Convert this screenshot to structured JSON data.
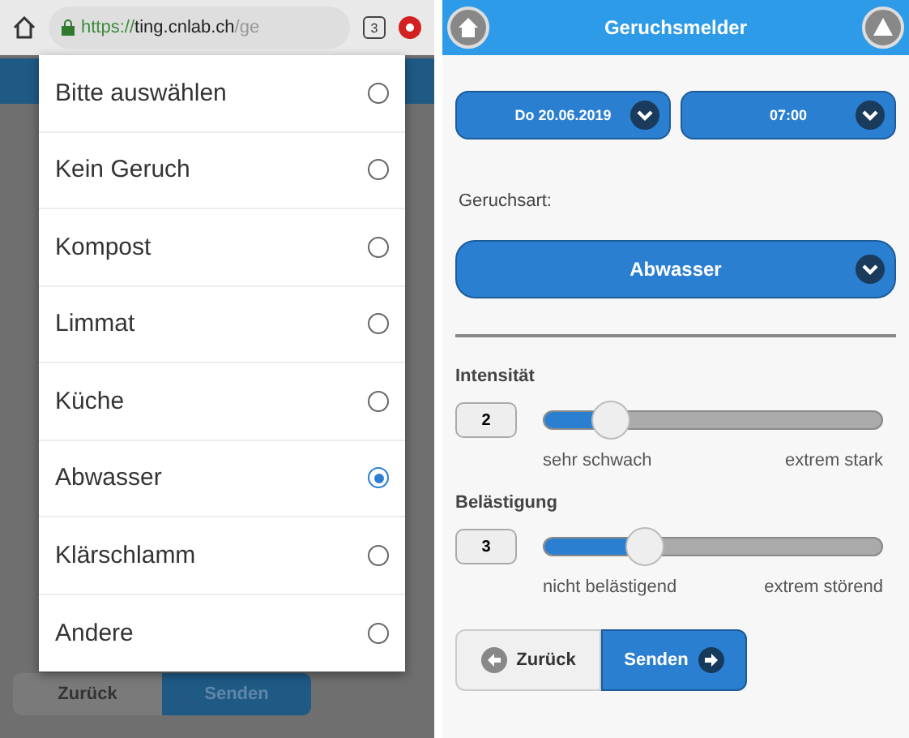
{
  "browser": {
    "url": {
      "scheme": "https://",
      "host": "ting.cnlab.ch",
      "path": "/ge"
    },
    "tab_count": "3"
  },
  "picker": {
    "options": [
      {
        "label": "Bitte auswählen",
        "selected": false
      },
      {
        "label": "Kein Geruch",
        "selected": false
      },
      {
        "label": "Kompost",
        "selected": false
      },
      {
        "label": "Limmat",
        "selected": false
      },
      {
        "label": "Küche",
        "selected": false
      },
      {
        "label": "Abwasser",
        "selected": true
      },
      {
        "label": "Klärschlamm",
        "selected": false
      },
      {
        "label": "Andere",
        "selected": false
      }
    ]
  },
  "background_buttons": [
    "Zurück",
    "Senden"
  ],
  "app": {
    "title": "Geruchsmelder",
    "date": "Do 20.06.2019",
    "time": "07:00",
    "odor_label": "Geruchsart:",
    "odor_value": "Abwasser",
    "sliders": [
      {
        "label": "Intensität",
        "value": "2",
        "level": 0.2,
        "min_label": "sehr schwach",
        "max_label": "extrem stark"
      },
      {
        "label": "Belästigung",
        "value": "3",
        "level": 0.3,
        "min_label": "nicht belästigend",
        "max_label": "extrem störend"
      }
    ],
    "buttons": [
      {
        "label": "Zurück",
        "kind": "back"
      },
      {
        "label": "Senden",
        "kind": "send"
      }
    ]
  }
}
